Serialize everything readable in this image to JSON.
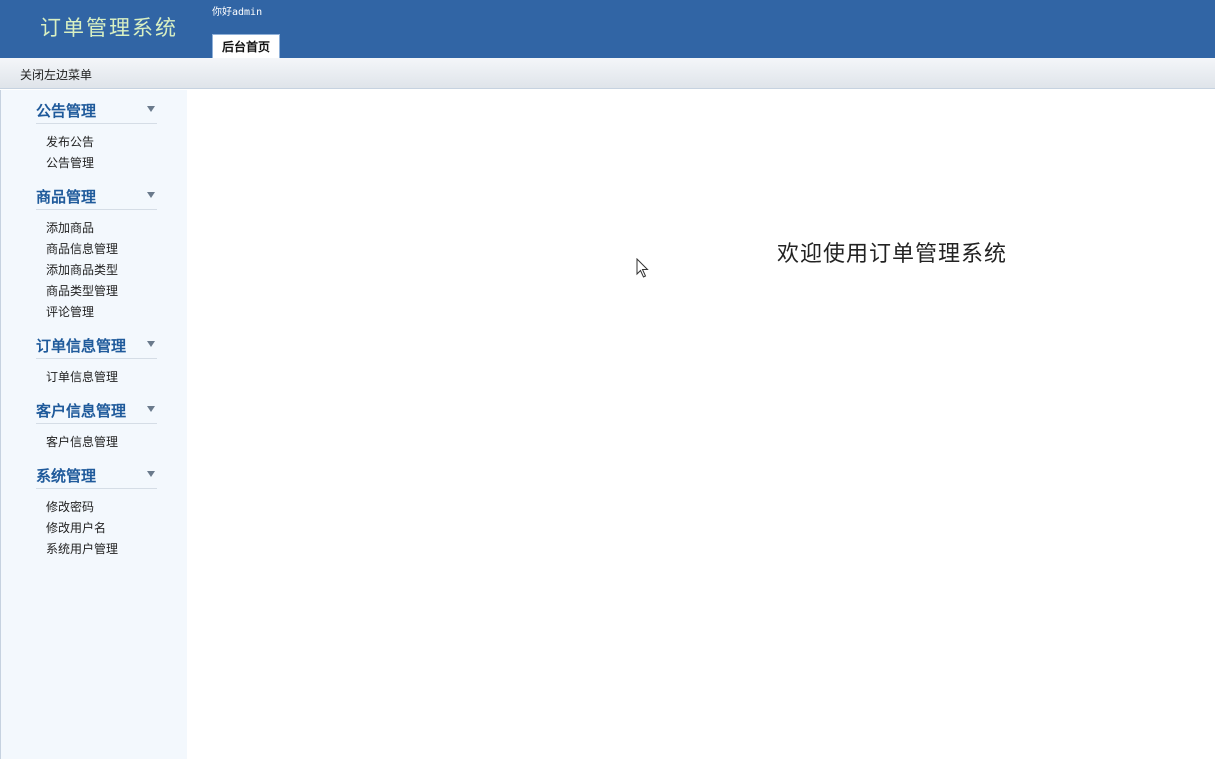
{
  "header": {
    "app_title": "订单管理系统",
    "greeting": "你好admin",
    "tabs": [
      {
        "label": "后台首页"
      }
    ]
  },
  "toolbar": {
    "toggle_menu_label": "关闭左边菜单"
  },
  "sidebar": {
    "groups": [
      {
        "title": "公告管理",
        "items": [
          "发布公告",
          "公告管理"
        ]
      },
      {
        "title": "商品管理",
        "items": [
          "添加商品",
          "商品信息管理",
          "添加商品类型",
          "商品类型管理",
          "评论管理"
        ]
      },
      {
        "title": "订单信息管理",
        "items": [
          "订单信息管理"
        ]
      },
      {
        "title": "客户信息管理",
        "items": [
          "客户信息管理"
        ]
      },
      {
        "title": "系统管理",
        "items": [
          "修改密码",
          "修改用户名",
          "系统用户管理"
        ]
      }
    ]
  },
  "main": {
    "welcome_text": "欢迎使用订单管理系统"
  },
  "colors": {
    "header_bg": "#3165a5",
    "title_color": "#d9f0c2",
    "sidebar_bg": "#f3f8fd",
    "group_title_color": "#1f5a9b"
  }
}
